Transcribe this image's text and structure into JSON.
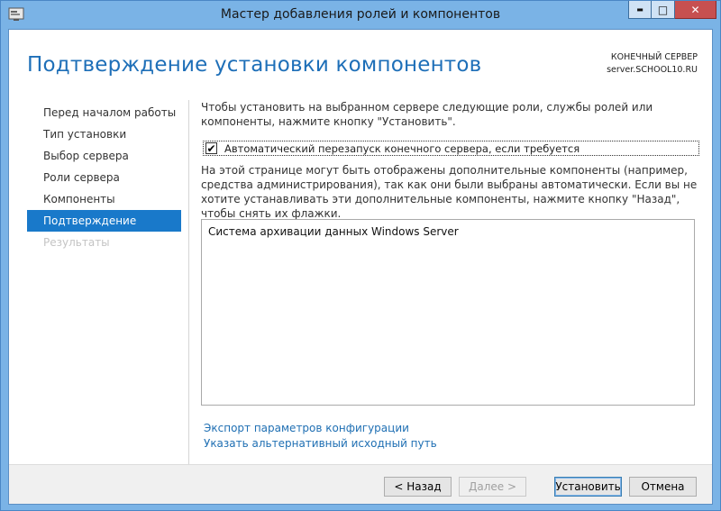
{
  "window": {
    "title": "Мастер добавления ролей и компонентов",
    "minimize_glyph": "▬",
    "maximize_glyph": "□",
    "close_glyph": "✕",
    "close_color": "#c75050"
  },
  "header": {
    "page_title": "Подтверждение установки компонентов",
    "server_label": "КОНЕЧНЫЙ СЕРВЕР",
    "server_name": "server.SCHOOL10.RU"
  },
  "nav": {
    "items": [
      {
        "label": "Перед началом работы",
        "state": "normal"
      },
      {
        "label": "Тип установки",
        "state": "normal"
      },
      {
        "label": "Выбор сервера",
        "state": "normal"
      },
      {
        "label": "Роли сервера",
        "state": "normal"
      },
      {
        "label": "Компоненты",
        "state": "normal"
      },
      {
        "label": "Подтверждение",
        "state": "active"
      },
      {
        "label": "Результаты",
        "state": "disabled"
      }
    ],
    "active_color": "#1979ca"
  },
  "main": {
    "intro": "Чтобы установить на выбранном сервере следующие роли, службы ролей или компоненты, нажмите кнопку \"Установить\".",
    "restart_checkbox": {
      "label": "Автоматический перезапуск конечного сервера, если требуется",
      "checked": true,
      "check_glyph": "✔"
    },
    "note": "На этой странице могут быть отображены дополнительные компоненты (например, средства администрирования), так как они были выбраны автоматически. Если вы не хотите устанавливать эти дополнительные компоненты, нажмите кнопку \"Назад\", чтобы снять их флажки.",
    "components": [
      "Система архивации данных Windows Server"
    ]
  },
  "links": {
    "export": "Экспорт параметров конфигурации",
    "alt_source": "Указать альтернативный исходный путь"
  },
  "buttons": {
    "back": "< Назад",
    "next": "Далее >",
    "install": "Установить",
    "cancel": "Отмена"
  }
}
